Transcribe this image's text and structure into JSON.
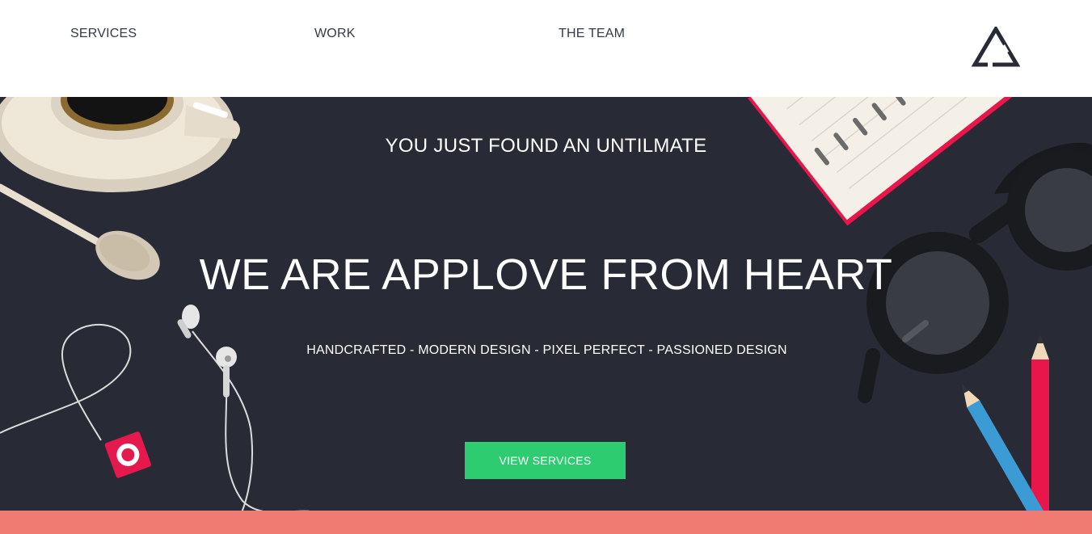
{
  "nav": {
    "items": [
      {
        "label": "SERVICES"
      },
      {
        "label": "WORK"
      },
      {
        "label": "THE TEAM"
      }
    ],
    "logo_icon": "triangle-logo-icon"
  },
  "hero": {
    "eyebrow": "YOU JUST FOUND AN UNTILMATE",
    "headline": "WE ARE APPLOVE FROM HEART",
    "tagline": "HANDCRAFTED - MODERN DESIGN - PIXEL PERFECT - PASSIONED DESIGN",
    "cta_label": "VIEW SERVICES",
    "decor_icons": [
      "coffee-cup-icon",
      "spoon-icon",
      "earphones-icon",
      "music-player-icon",
      "notebook-icon",
      "glasses-icon",
      "pencil-icon"
    ]
  },
  "colors": {
    "hero_bg": "#282b35",
    "accent_green": "#2ecc71",
    "band_coral": "#f07b72",
    "nav_text": "#333a44"
  }
}
